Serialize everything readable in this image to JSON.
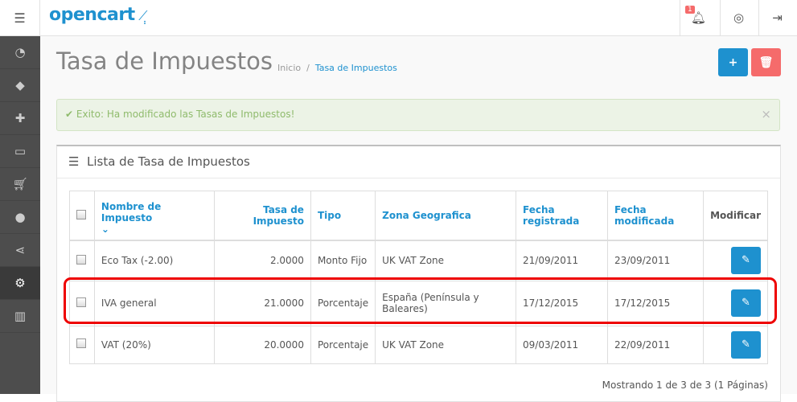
{
  "header": {
    "logo": "opencart",
    "notification_count": "1"
  },
  "page": {
    "title": "Tasa de Impuestos",
    "breadcrumb": [
      "Inicio",
      "Tasa de Impuestos"
    ]
  },
  "alert": {
    "text": "Exito: Ha modificado las Tasas de Impuestos!",
    "close": "×"
  },
  "panel": {
    "title": "Lista de Tasa de Impuestos"
  },
  "table": {
    "columns": [
      "Nombre de Impuesto",
      "Tasa de Impuesto",
      "Tipo",
      "Zona Geografica",
      "Fecha registrada",
      "Fecha modificada",
      "Modificar"
    ],
    "rows": [
      {
        "name": "Eco Tax (-2.00)",
        "rate": "2.0000",
        "type": "Monto Fijo",
        "zone": "UK VAT Zone",
        "added": "21/09/2011",
        "modified": "23/09/2011"
      },
      {
        "name": "IVA general",
        "rate": "21.0000",
        "type": "Porcentaje",
        "zone": "España (Península y Baleares)",
        "added": "17/12/2015",
        "modified": "17/12/2015"
      },
      {
        "name": "VAT (20%)",
        "rate": "20.0000",
        "type": "Porcentaje",
        "zone": "UK VAT Zone",
        "added": "09/03/2011",
        "modified": "22/09/2011"
      }
    ]
  },
  "pagination": "Mostrando 1 de 3 de 3 (1 Páginas)"
}
